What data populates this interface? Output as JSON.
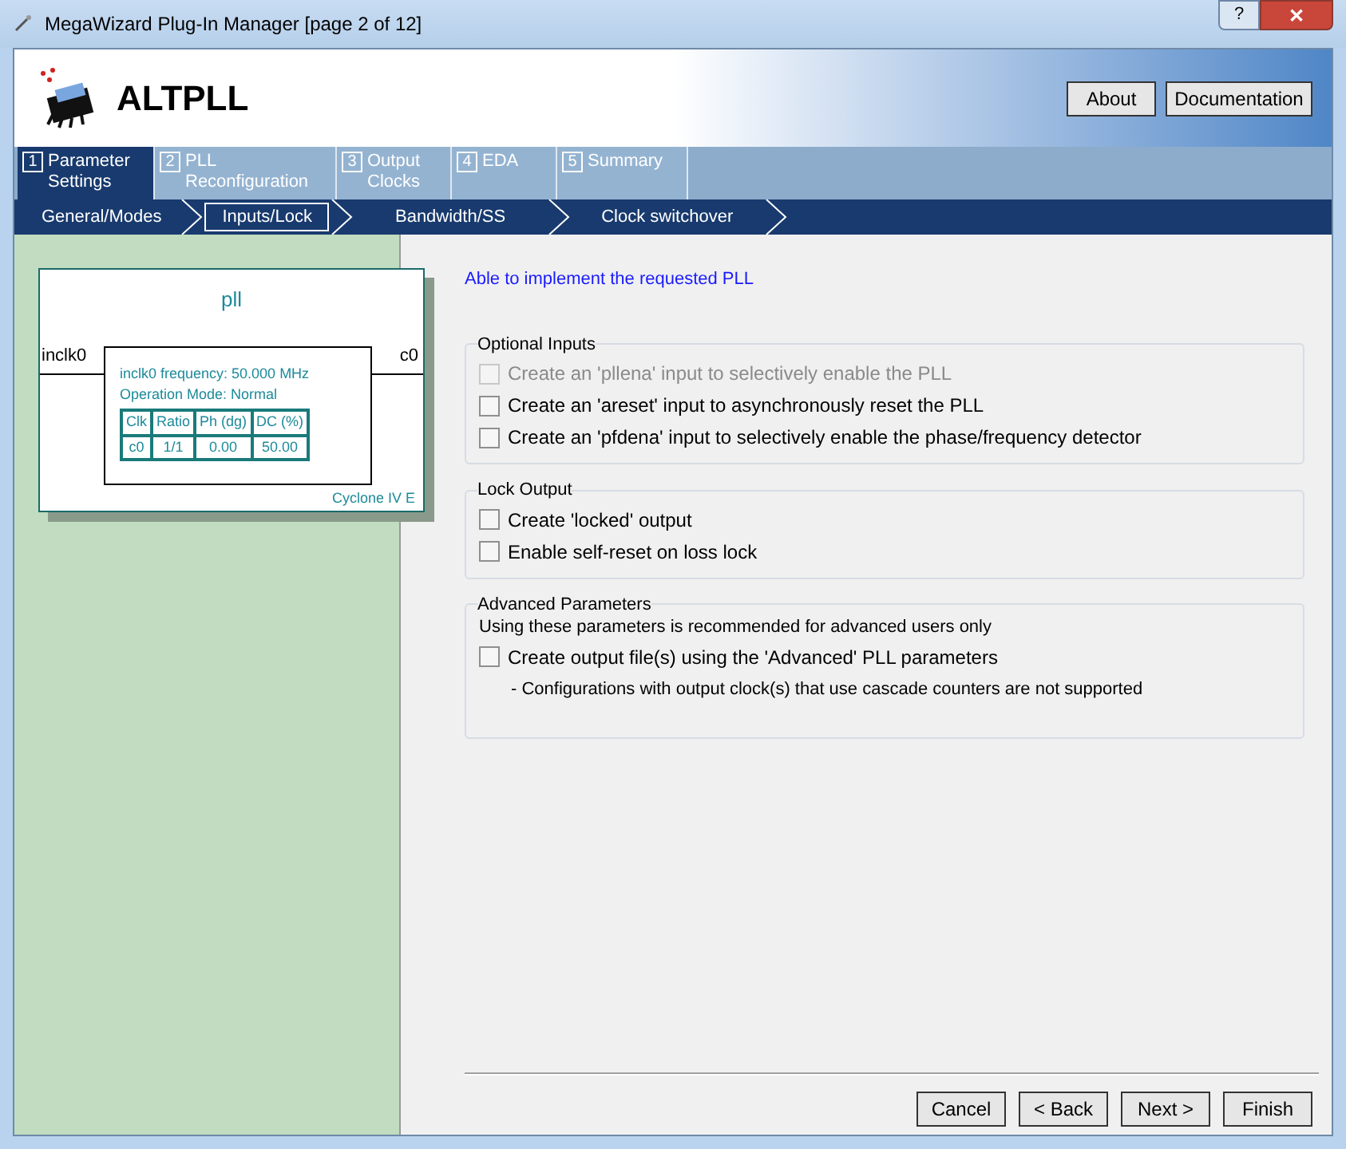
{
  "window": {
    "title": "MegaWizard Plug-In Manager [page 2 of 12]",
    "controls": [
      "?",
      "✕"
    ]
  },
  "header": {
    "title": "ALTPLL",
    "buttons": [
      "About",
      "Documentation"
    ]
  },
  "tabs": [
    {
      "number": "1",
      "label": "Parameter Settings",
      "selected": true
    },
    {
      "number": "2",
      "label": "PLL Reconfiguration",
      "selected": false
    },
    {
      "number": "3",
      "label": "Output Clocks",
      "selected": false
    },
    {
      "number": "4",
      "label": "EDA",
      "selected": false
    },
    {
      "number": "5",
      "label": "Summary",
      "selected": false
    }
  ],
  "subtabs": [
    {
      "label": "General/Modes",
      "selected": false
    },
    {
      "label": "Inputs/Lock",
      "selected": true
    },
    {
      "label": "Bandwidth/SS",
      "selected": false
    },
    {
      "label": "Clock switchover",
      "selected": false
    }
  ],
  "diagram": {
    "title": "pll",
    "input": "inclk0",
    "output": "c0",
    "info": [
      "inclk0 frequency: 50.000 MHz",
      "Operation Mode: Normal"
    ],
    "table": {
      "columns": [
        "Clk",
        "Ratio",
        "Ph (dg)",
        "DC (%)"
      ],
      "rows": [
        [
          "c0",
          "1/1",
          "0.00",
          "50.00"
        ]
      ]
    },
    "device": "Cyclone IV E"
  },
  "status": "Able to implement the requested PLL",
  "groups": [
    {
      "title": "Optional Inputs",
      "options": [
        {
          "label": "Create an 'pllena' input to selectively enable the PLL",
          "checked": false,
          "disabled": true
        },
        {
          "label": "Create an 'areset' input to asynchronously reset the PLL",
          "checked": false,
          "disabled": false
        },
        {
          "label": "Create an 'pfdena' input to selectively enable the phase/frequency detector",
          "checked": false,
          "disabled": false
        }
      ]
    },
    {
      "title": "Lock Output",
      "options": [
        {
          "label": "Create 'locked' output",
          "checked": false,
          "disabled": false
        },
        {
          "label": "Enable self-reset on loss lock",
          "checked": false,
          "disabled": false
        }
      ]
    },
    {
      "title": "Advanced Parameters",
      "description": "Using these parameters is recommended for advanced users only",
      "options": [
        {
          "label": "Create output file(s) using the 'Advanced' PLL parameters",
          "checked": false,
          "disabled": false
        }
      ],
      "note": "- Configurations with output clock(s) that use cascade counters are not supported"
    }
  ],
  "footer": {
    "buttons": [
      "Cancel",
      "< Back",
      "Next >",
      "Finish"
    ]
  }
}
